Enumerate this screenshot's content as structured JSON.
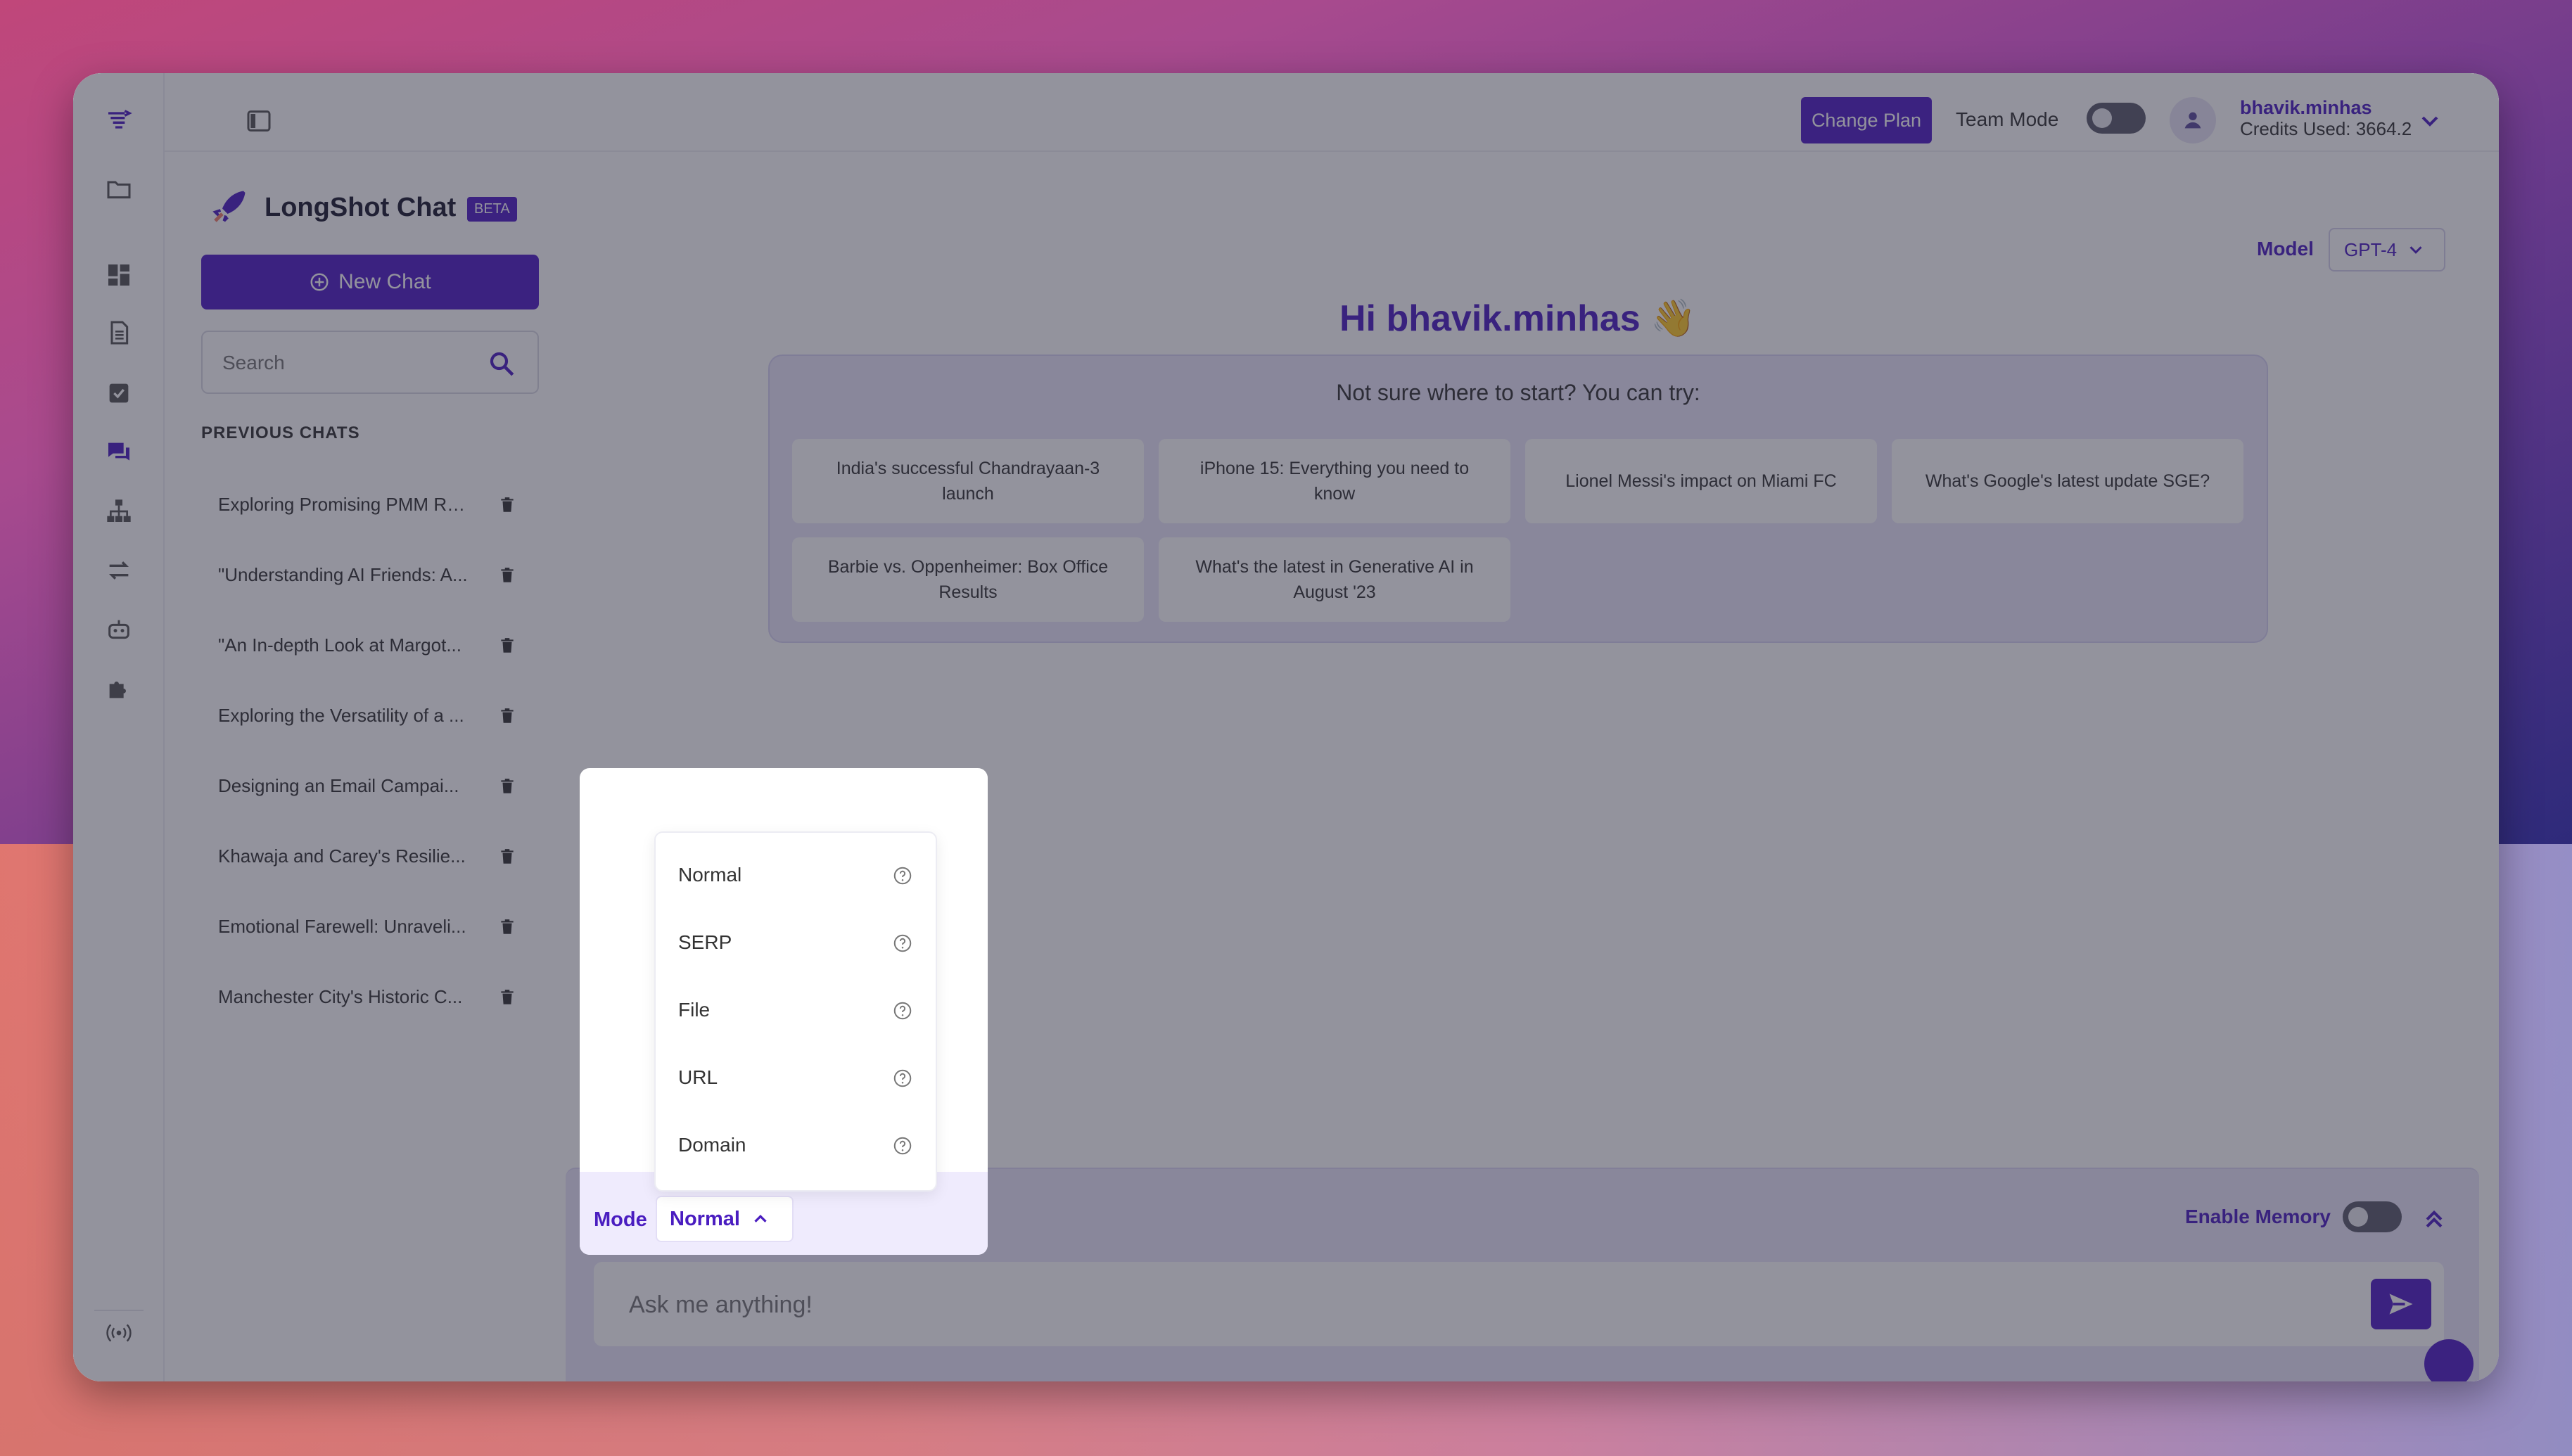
{
  "brand": {
    "title": "LongShot Chat",
    "badge": "BETA"
  },
  "topbar": {
    "change_plan": "Change Plan",
    "team_mode": "Team Mode",
    "user_name": "bhavik.minhas",
    "credits": "Credits Used: 3664.2"
  },
  "sidebar": {
    "new_chat": "New Chat",
    "search_placeholder": "Search",
    "previous_label": "PREVIOUS CHATS",
    "chats": [
      "Exploring Promising PMM Rol...",
      "\"Understanding AI Friends: A...",
      "\"An In-depth Look at Margot...",
      "Exploring the Versatility of a ...",
      "Designing an Email Campai...",
      "Khawaja and Carey's Resilie...",
      "Emotional Farewell: Unraveli...",
      "Manchester City's Historic C..."
    ]
  },
  "main": {
    "model_label": "Model",
    "model_value": "GPT-4",
    "greeting": "Hi bhavik.minhas 👋",
    "suggest_title": "Not sure where to start? You can try:",
    "suggestions": [
      "India's successful Chandrayaan-3 launch",
      "iPhone 15: Everything you need to know",
      "Lionel Messi's impact on Miami FC",
      "What's Google's latest update SGE?",
      "Barbie vs. Oppenheimer: Box Office Results",
      "What's the latest in Generative AI in August '23"
    ]
  },
  "composer": {
    "mode_label": "Mode",
    "mode_value": "Normal",
    "enable_memory": "Enable Memory",
    "placeholder": "Ask me anything!"
  },
  "mode_menu": {
    "options": [
      "Normal",
      "SERP",
      "File",
      "URL",
      "Domain"
    ]
  },
  "colors": {
    "accent": "#4f1dc5",
    "accent_text": "#4a1dc0"
  }
}
